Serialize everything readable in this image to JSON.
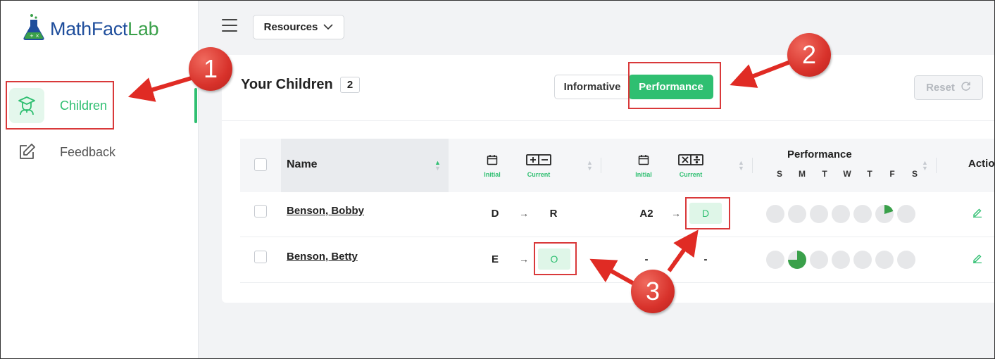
{
  "app": {
    "logo_part1": "MathFact",
    "logo_part2": "Lab"
  },
  "sidebar": {
    "items": [
      {
        "label": "Children",
        "icon": "graduate-icon",
        "active": true
      },
      {
        "label": "Feedback",
        "icon": "edit-icon",
        "active": false
      }
    ]
  },
  "topbar": {
    "resources_label": "Resources"
  },
  "main": {
    "title": "Your Children",
    "count": "2",
    "toggle": {
      "informative": "Informative",
      "performance": "Performance",
      "selected": "Performance"
    },
    "reset_label": "Reset",
    "table": {
      "headers": {
        "name": "Name",
        "initial": "Initial",
        "current": "Current",
        "performance": "Performance",
        "days": [
          "S",
          "M",
          "T",
          "W",
          "T",
          "F",
          "S"
        ],
        "actions": "Actio"
      },
      "rows": [
        {
          "name": "Benson, Bobby",
          "addsub_initial": "D",
          "addsub_current": "R",
          "muldiv_initial": "A2",
          "muldiv_current": "D",
          "performance_fractions": [
            0,
            0,
            0,
            0,
            0,
            0.2,
            0
          ]
        },
        {
          "name": "Benson, Betty",
          "addsub_initial": "E",
          "addsub_current": "O",
          "muldiv_initial": "-",
          "muldiv_current": "-",
          "performance_fractions": [
            0,
            0.75,
            0,
            0,
            0,
            0,
            0
          ]
        }
      ]
    }
  },
  "annotations": {
    "callouts": [
      "1",
      "2",
      "3"
    ],
    "color": "#d9393a"
  },
  "colors": {
    "accent": "#2fbf71",
    "brand_blue": "#1f4e9c",
    "brand_green": "#3aa04a",
    "annotation": "#d9393a"
  }
}
